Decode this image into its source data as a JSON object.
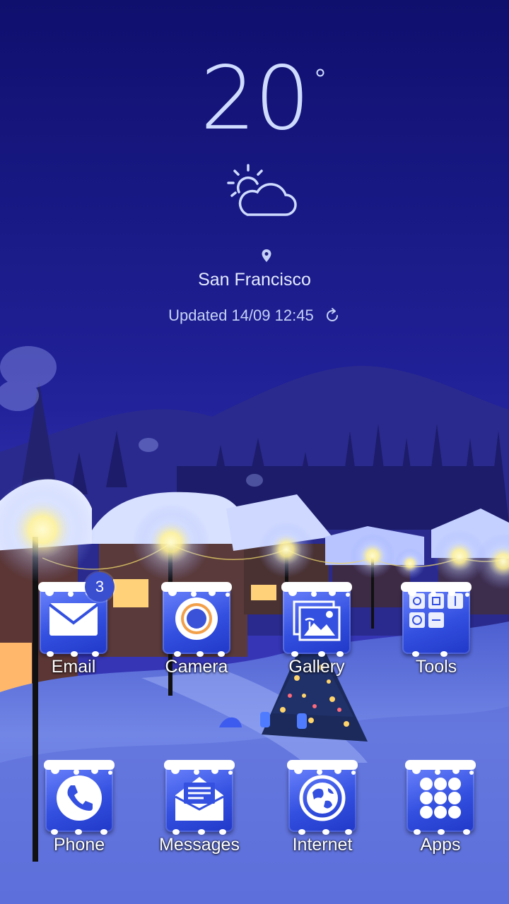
{
  "weather": {
    "temperature": "20",
    "icon": "partly-cloudy-icon",
    "location_icon": "location-pin-icon",
    "location": "San Francisco",
    "updated": "Updated 14/09 12:45",
    "refresh_icon": "refresh-icon"
  },
  "home_row": [
    {
      "label": "Email",
      "icon": "envelope-icon",
      "badge": "3"
    },
    {
      "label": "Camera",
      "icon": "camera-lens-icon"
    },
    {
      "label": "Gallery",
      "icon": "picture-icon"
    },
    {
      "label": "Tools",
      "icon": "tools-folder-icon"
    }
  ],
  "dock": [
    {
      "label": "Phone",
      "icon": "phone-handset-icon"
    },
    {
      "label": "Messages",
      "icon": "message-envelope-icon"
    },
    {
      "label": "Internet",
      "icon": "globe-icon"
    },
    {
      "label": "Apps",
      "icon": "apps-grid-icon"
    }
  ],
  "colors": {
    "sky_top": "#101070",
    "sky_bottom": "#3a3ab8",
    "snow": "#8fa2ea",
    "tile_accent": "#3350e0",
    "lamp_glow": "#fff6a8"
  }
}
